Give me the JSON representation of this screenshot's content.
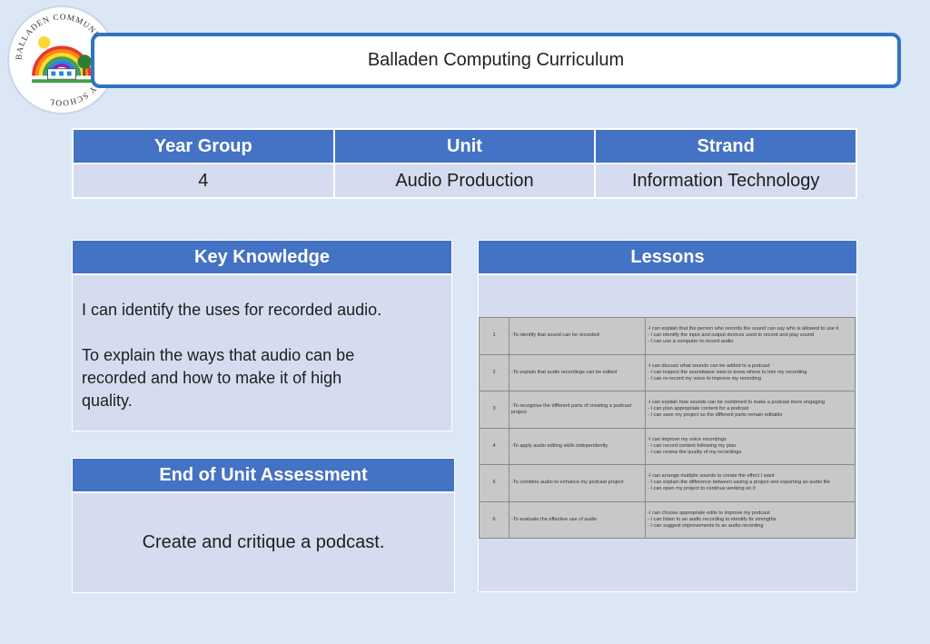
{
  "logo": {
    "text": "BALLADEN COMMUNITY PRIMARY SCHOOL",
    "colors": [
      "#e53935",
      "#fb8c00",
      "#fdd835",
      "#43a047",
      "#1e88e5",
      "#8e24aa"
    ]
  },
  "header": {
    "title": "Balladen Computing Curriculum"
  },
  "info_table": {
    "headers": [
      "Year Group",
      "Unit",
      "Strand"
    ],
    "values": [
      "4",
      "Audio Production",
      "Information Technology"
    ]
  },
  "key_knowledge": {
    "heading": "Key Knowledge",
    "items": [
      "I can identify the uses for recorded audio.",
      "To explain the ways that audio can be recorded and how to make it of high quality."
    ]
  },
  "assessment": {
    "heading": "End of Unit Assessment",
    "text": "Create and critique a podcast."
  },
  "lessons": {
    "heading": "Lessons",
    "rows": [
      {
        "number": "1",
        "objective": "-To identify that sound can be recorded",
        "criteria": [
          "-I can explain that the person who records the sound can say who is allowed to use it",
          "- I can identify the input and output devices used to record and play sound",
          "- I can use a computer to record audio"
        ]
      },
      {
        "number": "2",
        "objective": "-To explain that audio recordings can be edited",
        "criteria": [
          "-I can discuss what sounds can be added to a podcast",
          "- I can inspect the soundwave view to know where to trim my recording",
          "- I can re-record my voice to improve my recording"
        ]
      },
      {
        "number": "3",
        "objective": "-To recognise the different parts of creating a podcast project",
        "criteria": [
          "-I can explain how sounds can be combined to make a podcast more engaging",
          "- I can plan appropriate content for a podcast",
          "- I can save my project so the different parts remain editable"
        ]
      },
      {
        "number": "4",
        "objective": "-To apply audio editing skills independently",
        "criteria": [
          "-I can improve my voice recordings",
          "- I can record content following my plan",
          "- I can review the quality of my recordings"
        ]
      },
      {
        "number": "5",
        "objective": "-To combine audio to enhance my podcast project",
        "criteria": [
          "-I can arrange multiple sounds to create the effect I want",
          "- I can explain the difference between saving a project and exporting an audio file",
          "- I can open my project to continue working on it"
        ]
      },
      {
        "number": "6",
        "objective": "-To evaluate the effective use of audio",
        "criteria": [
          "-I can choose appropriate edits to improve my podcast",
          "- I can listen to an audio recording to identify its strengths",
          "- I can suggest improvements to an audio recording"
        ]
      }
    ]
  }
}
